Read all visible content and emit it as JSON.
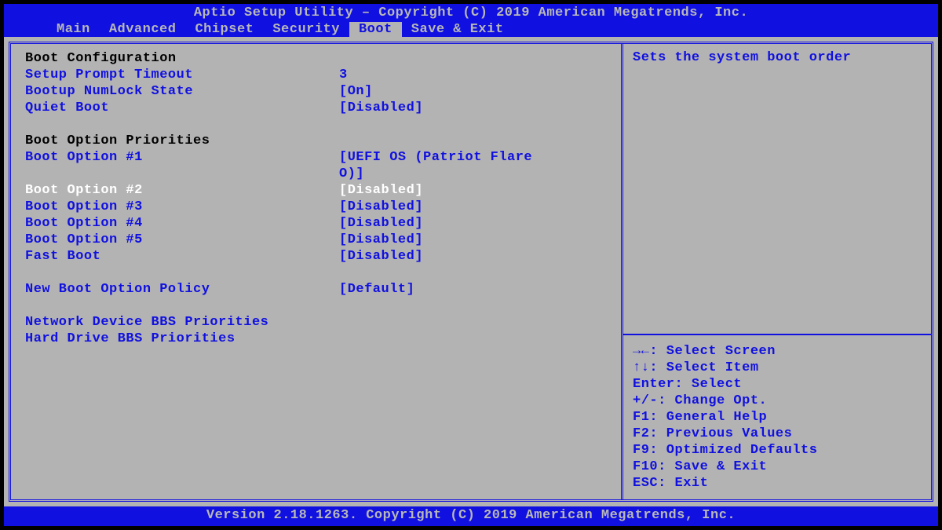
{
  "header": {
    "title": "Aptio Setup Utility – Copyright (C) 2019 American Megatrends, Inc."
  },
  "tabs": [
    {
      "label": "Main",
      "active": false
    },
    {
      "label": "Advanced",
      "active": false
    },
    {
      "label": "Chipset",
      "active": false
    },
    {
      "label": "Security",
      "active": false
    },
    {
      "label": "Boot",
      "active": true
    },
    {
      "label": "Save & Exit",
      "active": false
    }
  ],
  "main": {
    "section1_title": "Boot Configuration",
    "setup_prompt_timeout_label": "Setup Prompt Timeout",
    "setup_prompt_timeout_value": "3",
    "bootup_numlock_label": "Bootup NumLock State",
    "bootup_numlock_value": "[On]",
    "quiet_boot_label": "Quiet Boot",
    "quiet_boot_value": "[Disabled]",
    "section2_title": "Boot Option Priorities",
    "boot1_label": "Boot Option #1",
    "boot1_value_line1": "[UEFI OS (Patriot Flare",
    "boot1_value_line2": "O)]",
    "boot2_label": "Boot Option #2",
    "boot2_value": "[Disabled]",
    "boot3_label": "Boot Option #3",
    "boot3_value": "[Disabled]",
    "boot4_label": "Boot Option #4",
    "boot4_value": "[Disabled]",
    "boot5_label": "Boot Option #5",
    "boot5_value": "[Disabled]",
    "fast_boot_label": "Fast Boot",
    "fast_boot_value": "[Disabled]",
    "new_boot_policy_label": "New Boot Option Policy",
    "new_boot_policy_value": "[Default]",
    "network_bbs_label": "Network Device BBS Priorities",
    "hdd_bbs_label": "Hard Drive BBS Priorities"
  },
  "help": {
    "text": "Sets the system boot order"
  },
  "hints": [
    "→←: Select Screen",
    "↑↓: Select Item",
    "Enter: Select",
    "+/-: Change Opt.",
    "F1: General Help",
    "F2: Previous Values",
    "F9: Optimized Defaults",
    "F10: Save & Exit",
    "ESC: Exit"
  ],
  "footer": {
    "text": "Version 2.18.1263. Copyright (C) 2019 American Megatrends, Inc."
  }
}
